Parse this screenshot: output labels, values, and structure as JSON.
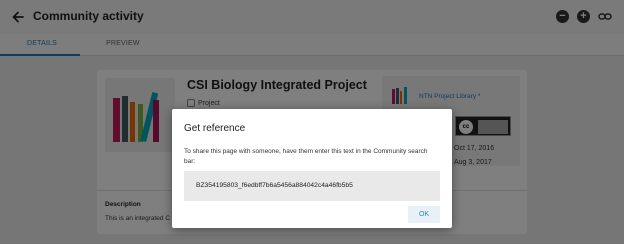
{
  "header": {
    "title": "Community activity"
  },
  "tabs": [
    {
      "label": "DETAILS",
      "active": true
    },
    {
      "label": "PREVIEW",
      "active": false
    }
  ],
  "resource": {
    "title": "CSI Biology Integrated Project",
    "type": "Project",
    "library_name": "NTN Project Library *",
    "date_1": "Oct 17, 2016",
    "date_2": "Aug 3, 2017",
    "description_label": "Description",
    "description_text": "This is an integrated C"
  },
  "dialog": {
    "title": "Get reference",
    "message": "To share this page with someone, have them enter this text in the Community search bar:",
    "reference": "BZ354195803_f6edbff7b6a5456a884042c4a46fb5b5",
    "ok_label": "OK"
  },
  "colors": {
    "accent": "#1a7bbf",
    "ok_button_bg": "#e8f1fa",
    "scrim": "rgba(0,0,0,0.5)"
  },
  "icons": [
    "back-arrow-icon",
    "zoom-out-icon",
    "zoom-in-icon",
    "link-icon",
    "project-type-icon",
    "creative-commons-icon"
  ]
}
